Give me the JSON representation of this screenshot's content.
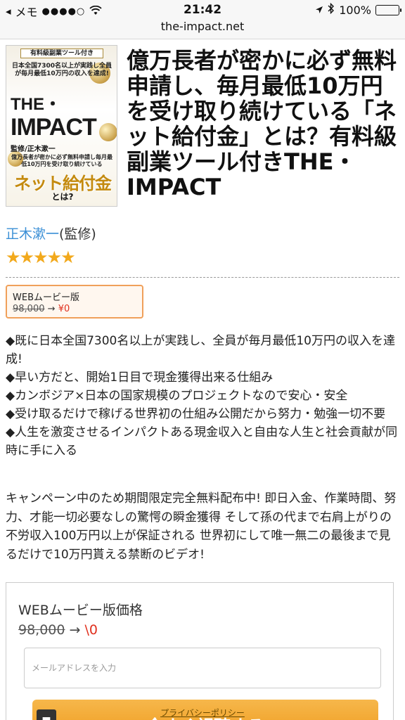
{
  "status_bar": {
    "app_back_label": "メモ",
    "signal": "●●●●○",
    "time": "21:42",
    "battery_text": "100%",
    "battery_level": 1.0
  },
  "url_bar": {
    "domain": "the-impact.net"
  },
  "product": {
    "cover": {
      "banner": "有料級副業ツール付き",
      "lead": "日本全国7300名以上が実践し全員が毎月最低10万円の収入を達成!",
      "title_line1": "THE・",
      "title_line2": "IMPACT",
      "supervisor": "監修/正木漱一",
      "sub": "億万長者が密かに必ず無料申請し毎月最低10万円を受け取り続けている",
      "main": "ネット給付金",
      "tail": "とは?"
    },
    "title": "億万長者が密かに必ず無料申請し、毎月最低10万円を受け取り続けている「ネット給付金」とは？有料級副業ツール付きTHE・IMPACT",
    "author_name": "正木漱一",
    "author_role": "(監修)",
    "rating_stars": "★★★★★",
    "rating": 5
  },
  "price_box": {
    "label": "WEBムービー版",
    "original_price": "98,000",
    "arrow": "→",
    "sale_price": "¥0"
  },
  "features": [
    "◆既に日本全国7300名以上が実践し、全員が毎月最低10万円の収入を達成!",
    "◆早い方だと、開始1日目で現金獲得出来る仕組み",
    "◆カンボジア×日本の国家規模のプロジェクトなので安心・安全",
    "◆受け取るだけで稼げる世界初の仕組み公開だから努力・勉強一切不要",
    "◆人生を激変させるインパクトある現金収入と自由な人生と社会貢献が同時に手に入る"
  ],
  "campaign_text": "キャンペーン中のため期間限定完全無料配布中! 即日入金、作業時間、努力、才能一切必要なしの驚愕の瞬金獲得 そして孫の代まで右肩上がりの不労収入100万円以上が保証される 世界初にして唯一無二の最後まで見るだけで10万円貰える禁断のビデオ!",
  "form": {
    "label": "WEBムービー版価格",
    "original_price": "98,000",
    "arrow": "→",
    "sale_price": "\\0",
    "email_placeholder": "メールアドレスを入力",
    "button_label": "今すぐ視聴する",
    "privacy_link": "プライバシーポリシー"
  }
}
